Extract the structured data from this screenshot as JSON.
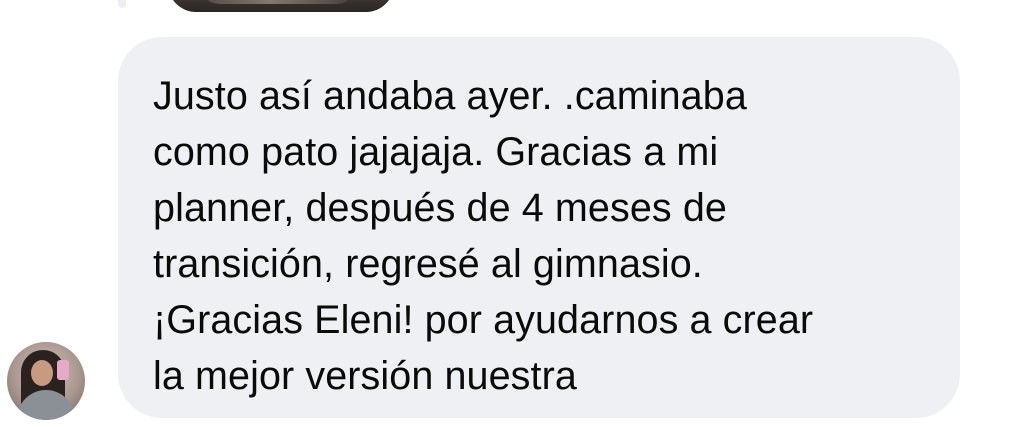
{
  "chat": {
    "message": {
      "lines": [
        "Justo así andaba ayer. .caminaba",
        "como pato jajajaja. Gracias a mi",
        "planner, después de 4 meses de",
        "transición, regresé al gimnasio.",
        "¡Gracias Eleni! por ayudarnos a crear",
        "la mejor versión nuestra"
      ]
    },
    "colors": {
      "bubble_background": "#eff0f3",
      "text": "#0a0a0a",
      "page_background": "#ffffff"
    }
  }
}
